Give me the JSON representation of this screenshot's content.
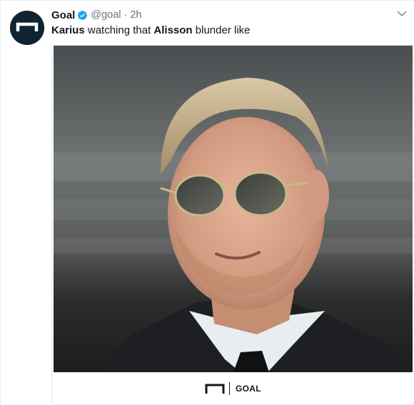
{
  "tweet": {
    "author": {
      "display_name": "Goal",
      "handle": "@goal",
      "verified_icon": "verified-badge-icon",
      "avatar_icon": "goal-logo-icon"
    },
    "separator": "·",
    "timestamp": "2h",
    "text_parts": [
      {
        "text": "Karius",
        "bold": true
      },
      {
        "text": " watching that ",
        "bold": false
      },
      {
        "text": "Alisson",
        "bold": true
      },
      {
        "text": " blunder like",
        "bold": false
      }
    ],
    "menu_icon": "chevron-down-icon",
    "media": {
      "footer_brand": "GOAL",
      "footer_icon": "goal-logo-icon"
    },
    "colors": {
      "name": "#14171a",
      "secondary": "#657786",
      "verified": "#1da1f2",
      "avatar_bg": "#0f2433"
    }
  }
}
